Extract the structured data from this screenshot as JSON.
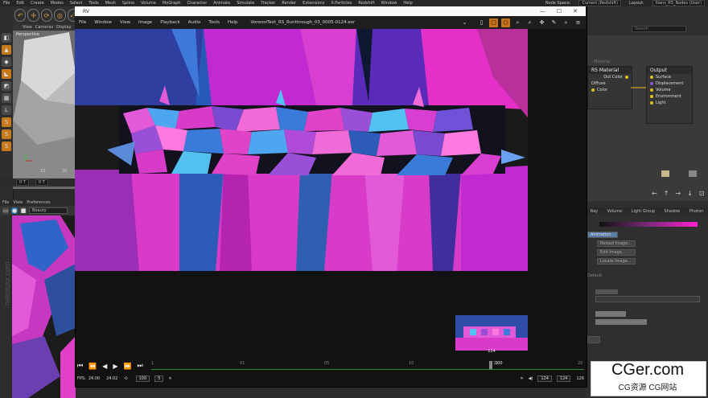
{
  "menubar": {
    "items": [
      "File",
      "Edit",
      "Create",
      "Modes",
      "Select",
      "Tools",
      "Mesh",
      "Spline",
      "Volume",
      "MoGraph",
      "Character",
      "Animate",
      "Simulate",
      "Tracker",
      "Render",
      "Extensions",
      "X-Particles",
      "Redshift",
      "Window",
      "Help"
    ],
    "node_space_label": "Node Space:",
    "node_space_value": "Current (Redshift)",
    "layout_label": "Layout:",
    "layout_value": "Ilians_RS_Nodes (User)"
  },
  "viewport": {
    "menu": [
      "View",
      "Cameras",
      "Display"
    ],
    "label": "Perspective",
    "ruler": [
      "10",
      "20"
    ],
    "coords": [
      "0 T",
      "0 T"
    ]
  },
  "bottom_left": {
    "menu": [
      "File",
      "View",
      "Preferences"
    ],
    "select_value": "Beauty",
    "watermark": "helloluxx.com"
  },
  "render_view": {
    "title": "RV",
    "menu": [
      "File",
      "Window",
      "View",
      "Image",
      "Playback",
      "Audio",
      "Tools",
      "Help"
    ],
    "filename": "VoronoiText_RS_Runthrough_03_0005-0124.exr",
    "thumb_frame": "114",
    "frame_start": "100",
    "frame_end": "120",
    "timeline_ticks": [
      "1",
      "01",
      "05",
      "10",
      "15",
      "20"
    ],
    "current_frame": "100",
    "fps_label": "FPS:",
    "fps_value": "24.00",
    "fps_actual": "24.02",
    "in_value": "100",
    "step_value": "5",
    "range_start": "124",
    "range_end": "124",
    "end_label": "126"
  },
  "node_editor": {
    "search_placeholder": "Search",
    "material_label": "Material",
    "node_material": {
      "title": "RS Material",
      "output_port": "Out Color",
      "section": "Diffuse",
      "row": "Color"
    },
    "node_output": {
      "title": "Output",
      "ports": [
        "Surface",
        "Displacement",
        "Volume",
        "Environment",
        "Light"
      ]
    }
  },
  "attributes": {
    "tabs": [
      "Ray",
      "Volume",
      "Light Group",
      "Shadow",
      "Photon"
    ],
    "animation_label": "Animation",
    "buttons": [
      "Reload Image...",
      "Edit Image...",
      "Locate Image..."
    ],
    "default_label": "Default"
  },
  "colors": {
    "accent_orange": "#c8731c",
    "magenta": "#e21fc8",
    "blue": "#2f5fa8",
    "port_yellow": "#e0c020",
    "port_purple": "#8a5ad0"
  },
  "watermark": {
    "main": "CGer.com",
    "sub": "CG资源 CG网站"
  }
}
